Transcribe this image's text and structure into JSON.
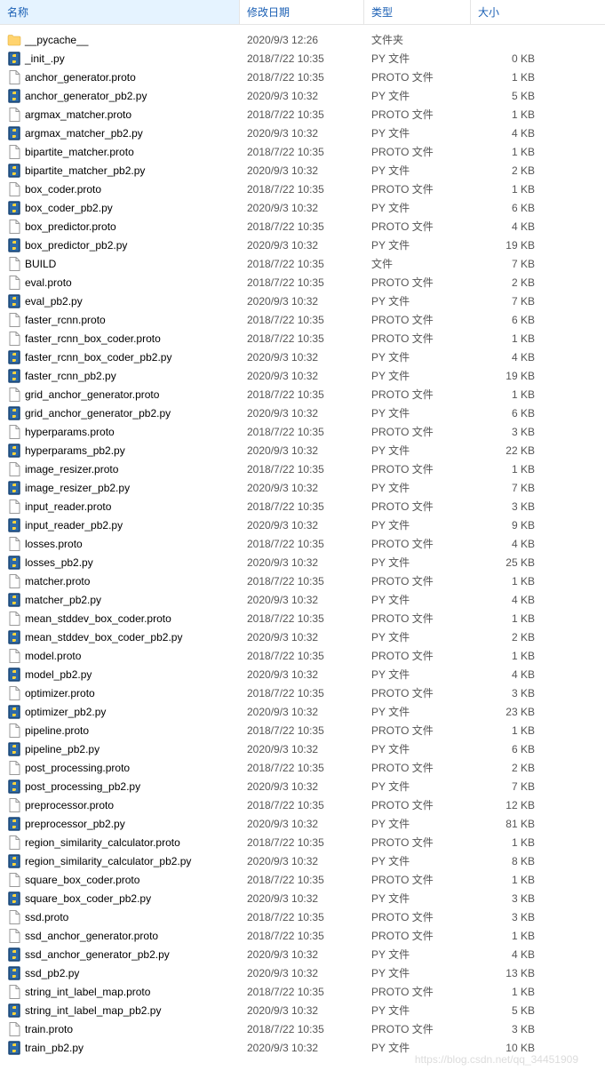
{
  "columns": {
    "name": "名称",
    "date": "修改日期",
    "type": "类型",
    "size": "大小"
  },
  "iconTypes": {
    "folder": "folder",
    "py": "py",
    "file": "file"
  },
  "files": [
    {
      "name": "__pycache__",
      "date": "2020/9/3 12:26",
      "type": "文件夹",
      "size": "",
      "icon": "folder"
    },
    {
      "name": "_init_.py",
      "date": "2018/7/22 10:35",
      "type": "PY 文件",
      "size": "0 KB",
      "icon": "py"
    },
    {
      "name": "anchor_generator.proto",
      "date": "2018/7/22 10:35",
      "type": "PROTO 文件",
      "size": "1 KB",
      "icon": "file"
    },
    {
      "name": "anchor_generator_pb2.py",
      "date": "2020/9/3 10:32",
      "type": "PY 文件",
      "size": "5 KB",
      "icon": "py"
    },
    {
      "name": "argmax_matcher.proto",
      "date": "2018/7/22 10:35",
      "type": "PROTO 文件",
      "size": "1 KB",
      "icon": "file"
    },
    {
      "name": "argmax_matcher_pb2.py",
      "date": "2020/9/3 10:32",
      "type": "PY 文件",
      "size": "4 KB",
      "icon": "py"
    },
    {
      "name": "bipartite_matcher.proto",
      "date": "2018/7/22 10:35",
      "type": "PROTO 文件",
      "size": "1 KB",
      "icon": "file"
    },
    {
      "name": "bipartite_matcher_pb2.py",
      "date": "2020/9/3 10:32",
      "type": "PY 文件",
      "size": "2 KB",
      "icon": "py"
    },
    {
      "name": "box_coder.proto",
      "date": "2018/7/22 10:35",
      "type": "PROTO 文件",
      "size": "1 KB",
      "icon": "file"
    },
    {
      "name": "box_coder_pb2.py",
      "date": "2020/9/3 10:32",
      "type": "PY 文件",
      "size": "6 KB",
      "icon": "py"
    },
    {
      "name": "box_predictor.proto",
      "date": "2018/7/22 10:35",
      "type": "PROTO 文件",
      "size": "4 KB",
      "icon": "file"
    },
    {
      "name": "box_predictor_pb2.py",
      "date": "2020/9/3 10:32",
      "type": "PY 文件",
      "size": "19 KB",
      "icon": "py"
    },
    {
      "name": "BUILD",
      "date": "2018/7/22 10:35",
      "type": "文件",
      "size": "7 KB",
      "icon": "file"
    },
    {
      "name": "eval.proto",
      "date": "2018/7/22 10:35",
      "type": "PROTO 文件",
      "size": "2 KB",
      "icon": "file"
    },
    {
      "name": "eval_pb2.py",
      "date": "2020/9/3 10:32",
      "type": "PY 文件",
      "size": "7 KB",
      "icon": "py"
    },
    {
      "name": "faster_rcnn.proto",
      "date": "2018/7/22 10:35",
      "type": "PROTO 文件",
      "size": "6 KB",
      "icon": "file"
    },
    {
      "name": "faster_rcnn_box_coder.proto",
      "date": "2018/7/22 10:35",
      "type": "PROTO 文件",
      "size": "1 KB",
      "icon": "file"
    },
    {
      "name": "faster_rcnn_box_coder_pb2.py",
      "date": "2020/9/3 10:32",
      "type": "PY 文件",
      "size": "4 KB",
      "icon": "py"
    },
    {
      "name": "faster_rcnn_pb2.py",
      "date": "2020/9/3 10:32",
      "type": "PY 文件",
      "size": "19 KB",
      "icon": "py"
    },
    {
      "name": "grid_anchor_generator.proto",
      "date": "2018/7/22 10:35",
      "type": "PROTO 文件",
      "size": "1 KB",
      "icon": "file"
    },
    {
      "name": "grid_anchor_generator_pb2.py",
      "date": "2020/9/3 10:32",
      "type": "PY 文件",
      "size": "6 KB",
      "icon": "py"
    },
    {
      "name": "hyperparams.proto",
      "date": "2018/7/22 10:35",
      "type": "PROTO 文件",
      "size": "3 KB",
      "icon": "file"
    },
    {
      "name": "hyperparams_pb2.py",
      "date": "2020/9/3 10:32",
      "type": "PY 文件",
      "size": "22 KB",
      "icon": "py"
    },
    {
      "name": "image_resizer.proto",
      "date": "2018/7/22 10:35",
      "type": "PROTO 文件",
      "size": "1 KB",
      "icon": "file"
    },
    {
      "name": "image_resizer_pb2.py",
      "date": "2020/9/3 10:32",
      "type": "PY 文件",
      "size": "7 KB",
      "icon": "py"
    },
    {
      "name": "input_reader.proto",
      "date": "2018/7/22 10:35",
      "type": "PROTO 文件",
      "size": "3 KB",
      "icon": "file"
    },
    {
      "name": "input_reader_pb2.py",
      "date": "2020/9/3 10:32",
      "type": "PY 文件",
      "size": "9 KB",
      "icon": "py"
    },
    {
      "name": "losses.proto",
      "date": "2018/7/22 10:35",
      "type": "PROTO 文件",
      "size": "4 KB",
      "icon": "file"
    },
    {
      "name": "losses_pb2.py",
      "date": "2020/9/3 10:32",
      "type": "PY 文件",
      "size": "25 KB",
      "icon": "py"
    },
    {
      "name": "matcher.proto",
      "date": "2018/7/22 10:35",
      "type": "PROTO 文件",
      "size": "1 KB",
      "icon": "file"
    },
    {
      "name": "matcher_pb2.py",
      "date": "2020/9/3 10:32",
      "type": "PY 文件",
      "size": "4 KB",
      "icon": "py"
    },
    {
      "name": "mean_stddev_box_coder.proto",
      "date": "2018/7/22 10:35",
      "type": "PROTO 文件",
      "size": "1 KB",
      "icon": "file"
    },
    {
      "name": "mean_stddev_box_coder_pb2.py",
      "date": "2020/9/3 10:32",
      "type": "PY 文件",
      "size": "2 KB",
      "icon": "py"
    },
    {
      "name": "model.proto",
      "date": "2018/7/22 10:35",
      "type": "PROTO 文件",
      "size": "1 KB",
      "icon": "file"
    },
    {
      "name": "model_pb2.py",
      "date": "2020/9/3 10:32",
      "type": "PY 文件",
      "size": "4 KB",
      "icon": "py"
    },
    {
      "name": "optimizer.proto",
      "date": "2018/7/22 10:35",
      "type": "PROTO 文件",
      "size": "3 KB",
      "icon": "file"
    },
    {
      "name": "optimizer_pb2.py",
      "date": "2020/9/3 10:32",
      "type": "PY 文件",
      "size": "23 KB",
      "icon": "py"
    },
    {
      "name": "pipeline.proto",
      "date": "2018/7/22 10:35",
      "type": "PROTO 文件",
      "size": "1 KB",
      "icon": "file"
    },
    {
      "name": "pipeline_pb2.py",
      "date": "2020/9/3 10:32",
      "type": "PY 文件",
      "size": "6 KB",
      "icon": "py"
    },
    {
      "name": "post_processing.proto",
      "date": "2018/7/22 10:35",
      "type": "PROTO 文件",
      "size": "2 KB",
      "icon": "file"
    },
    {
      "name": "post_processing_pb2.py",
      "date": "2020/9/3 10:32",
      "type": "PY 文件",
      "size": "7 KB",
      "icon": "py"
    },
    {
      "name": "preprocessor.proto",
      "date": "2018/7/22 10:35",
      "type": "PROTO 文件",
      "size": "12 KB",
      "icon": "file"
    },
    {
      "name": "preprocessor_pb2.py",
      "date": "2020/9/3 10:32",
      "type": "PY 文件",
      "size": "81 KB",
      "icon": "py"
    },
    {
      "name": "region_similarity_calculator.proto",
      "date": "2018/7/22 10:35",
      "type": "PROTO 文件",
      "size": "1 KB",
      "icon": "file"
    },
    {
      "name": "region_similarity_calculator_pb2.py",
      "date": "2020/9/3 10:32",
      "type": "PY 文件",
      "size": "8 KB",
      "icon": "py"
    },
    {
      "name": "square_box_coder.proto",
      "date": "2018/7/22 10:35",
      "type": "PROTO 文件",
      "size": "1 KB",
      "icon": "file"
    },
    {
      "name": "square_box_coder_pb2.py",
      "date": "2020/9/3 10:32",
      "type": "PY 文件",
      "size": "3 KB",
      "icon": "py"
    },
    {
      "name": "ssd.proto",
      "date": "2018/7/22 10:35",
      "type": "PROTO 文件",
      "size": "3 KB",
      "icon": "file"
    },
    {
      "name": "ssd_anchor_generator.proto",
      "date": "2018/7/22 10:35",
      "type": "PROTO 文件",
      "size": "1 KB",
      "icon": "file"
    },
    {
      "name": "ssd_anchor_generator_pb2.py",
      "date": "2020/9/3 10:32",
      "type": "PY 文件",
      "size": "4 KB",
      "icon": "py"
    },
    {
      "name": "ssd_pb2.py",
      "date": "2020/9/3 10:32",
      "type": "PY 文件",
      "size": "13 KB",
      "icon": "py"
    },
    {
      "name": "string_int_label_map.proto",
      "date": "2018/7/22 10:35",
      "type": "PROTO 文件",
      "size": "1 KB",
      "icon": "file"
    },
    {
      "name": "string_int_label_map_pb2.py",
      "date": "2020/9/3 10:32",
      "type": "PY 文件",
      "size": "5 KB",
      "icon": "py"
    },
    {
      "name": "train.proto",
      "date": "2018/7/22 10:35",
      "type": "PROTO 文件",
      "size": "3 KB",
      "icon": "file"
    },
    {
      "name": "train_pb2.py",
      "date": "2020/9/3 10:32",
      "type": "PY 文件",
      "size": "10 KB",
      "icon": "py"
    }
  ],
  "watermark": "https://blog.csdn.net/qq_34451909"
}
